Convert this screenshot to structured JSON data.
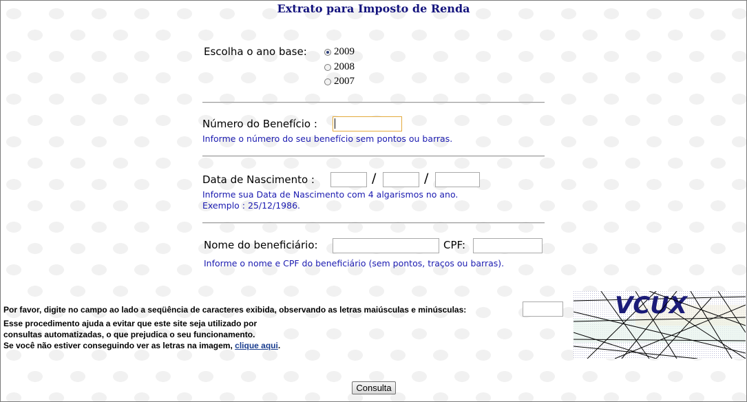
{
  "page": {
    "title": "Extrato para Imposto de Renda"
  },
  "ano_base": {
    "label": "Escolha o ano base:",
    "options": [
      "2009",
      "2008",
      "2007"
    ],
    "selected": "2009"
  },
  "beneficio": {
    "label": "Número do Benefício :",
    "value": "",
    "hint": "Informe o número do seu benefício sem pontos ou barras."
  },
  "nascimento": {
    "label": "Data de Nascimento :",
    "separator": "/",
    "day": "",
    "month": "",
    "year": "",
    "hint1": "Informe sua Data de Nascimento com 4 algarismos no ano.",
    "hint2": "Exemplo : 25/12/1986."
  },
  "beneficiario": {
    "nome_label": "Nome do beneficiário:",
    "nome_value": "",
    "cpf_label": "CPF:",
    "cpf_value": "",
    "hint": "Informe o nome e CPF do beneficiário (sem pontos, traços ou barras)."
  },
  "captcha": {
    "instruction": "Por favor, digite no campo ao lado a seqüência de caracteres exibida, observando as letras maiúsculas e minúsculas:",
    "explain1": "Esse procedimento ajuda a evitar que este site seja utilizado por",
    "explain2": "consultas automatizadas, o que prejudica o seu funcionamento.",
    "cant_see": "Se você não estiver conseguindo ver as letras na imagem,",
    "link": "clique aqui",
    "link_suffix": ".",
    "image_text": "VCUX",
    "value": ""
  },
  "submit": {
    "label": "Consulta"
  },
  "colors": {
    "title": "#14147d",
    "hint": "#1a1ab0",
    "focus_border": "#e3a93b"
  }
}
